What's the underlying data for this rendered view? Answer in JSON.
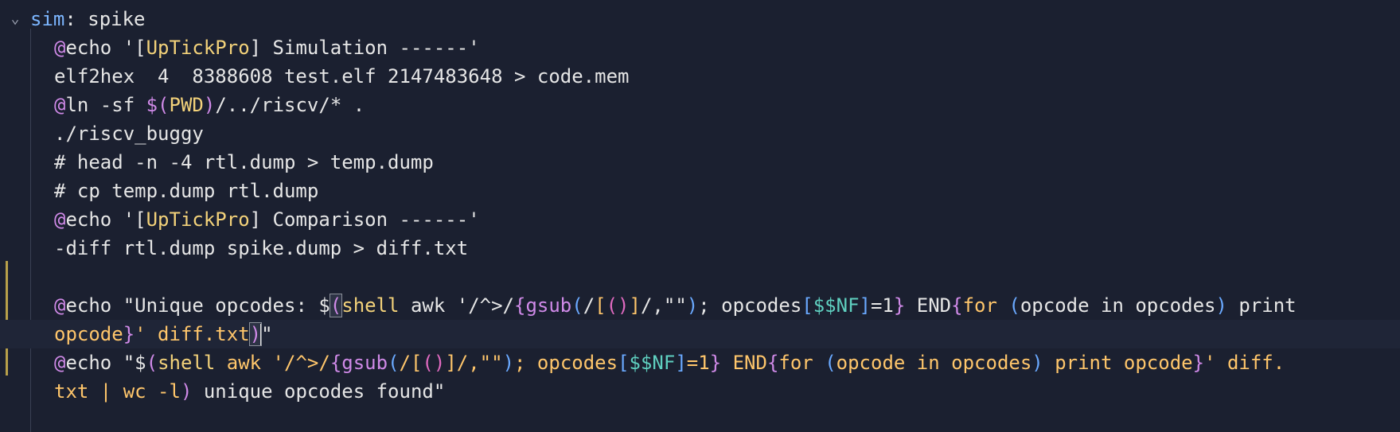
{
  "editor": {
    "fold_icon": "chevron-down-icon",
    "lines": [
      {
        "text": "sim: spike"
      },
      {
        "text": "@echo '[UpTickPro] Simulation ------'"
      },
      {
        "text": "elf2hex  4  8388608 test.elf 2147483648 > code.mem"
      },
      {
        "text": "@ln -sf $(PWD)/../riscv/* ."
      },
      {
        "text": "./riscv_buggy"
      },
      {
        "text": "# head -n -4 rtl.dump > temp.dump"
      },
      {
        "text": "# cp temp.dump rtl.dump"
      },
      {
        "text": "@echo '[UpTickPro] Comparison ------'"
      },
      {
        "text": "-diff rtl.dump spike.dump > diff.txt"
      },
      {
        "text": ""
      },
      {
        "text": "@echo \"Unique opcodes: $(shell awk '/^>/{gsub(/[()]/,\"\"); opcodes[$$NF]=1} END{for (opcode in opcodes) print"
      },
      {
        "text": "opcode}' diff.txt)\""
      },
      {
        "text": "@echo \"$(shell awk '/^>/{gsub(/[()]/,\"\"); opcodes[$$NF]=1} END{for (opcode in opcodes) print opcode}' diff."
      },
      {
        "text": "txt | wc -l) unique opcodes found\""
      }
    ],
    "tokens": {
      "l0_target": "sim",
      "l0_rest": ": spike",
      "l1_at": "@",
      "l1_cmd": "echo",
      "l1_s1": " '[",
      "l1_name": "UpTickPro",
      "l1_s2": "] Simulation ------'",
      "l2": "elf2hex  4  8388608 test.elf 2147483648 > code.mem",
      "l3_at": "@",
      "l3_a": "ln -sf ",
      "l3_d": "$(",
      "l3_var": "PWD",
      "l3_p": ")",
      "l3_b": "/../riscv/* .",
      "l4": "./riscv_buggy",
      "l5": "# head -n -4 rtl.dump > temp.dump",
      "l6": "# cp temp.dump rtl.dump",
      "l7_at": "@",
      "l7_cmd": "echo",
      "l7_s1": " '[",
      "l7_name": "UpTickPro",
      "l7_s2": "] Comparison ------'",
      "l8": "-diff rtl.dump spike.dump > diff.txt",
      "l10_at": "@",
      "l10_cmd": "echo",
      "l10_s1": " \"Unique opcodes: $",
      "l10_po": "(",
      "l10_shell": "shell",
      "l10_s2": " awk '/^>/",
      "l10_b1": "{",
      "l10_gsub": "gsub",
      "l10_p1": "(",
      "l10_s3": "/",
      "l10_br1": "[",
      "l10_p2": "()",
      "l10_br2": "]",
      "l10_s4": "/,\"\"",
      "l10_p3": ")",
      "l10_s5": "; opcodes",
      "l10_br3": "[",
      "l10_nf": "$$NF",
      "l10_br4": "]",
      "l10_s6": "=1",
      "l10_b2": "}",
      "l10_s7": " END",
      "l10_b3": "{",
      "l10_for": "for",
      "l10_s8": " ",
      "l10_p4": "(",
      "l10_s9": "opcode in opcodes",
      "l10_p5": ")",
      "l10_s10": " print",
      "l11_a": "opcode",
      "l11_b": "}",
      "l11_c": "' diff.txt",
      "l11_p": ")",
      "l11_q": "\"",
      "l12_at": "@",
      "l12_cmd": "echo",
      "l12_s1": " \"$",
      "l12_po": "(",
      "l12_shell": "shell",
      "l12_s2": " awk '/^>/",
      "l12_b1": "{",
      "l12_gsub": "gsub",
      "l12_p1": "(",
      "l12_s3": "/",
      "l12_br1": "[",
      "l12_p2": "()",
      "l12_br2": "]",
      "l12_s4": "/,\"\"",
      "l12_p3": ")",
      "l12_s5": "; opcodes",
      "l12_br3": "[",
      "l12_nf": "$$NF",
      "l12_br4": "]",
      "l12_s6": "=1",
      "l12_b2": "}",
      "l12_s7": " END",
      "l12_b3": "{",
      "l12_for": "for",
      "l12_s8": " ",
      "l12_p4": "(",
      "l12_s9": "opcode in opcodes",
      "l12_p5": ")",
      "l12_s10": " print opcode",
      "l12_b4": "}",
      "l12_s11": "' diff.",
      "l13_a": "txt | wc -l",
      "l13_p": ")",
      "l13_b": " unique opcodes found\""
    }
  }
}
